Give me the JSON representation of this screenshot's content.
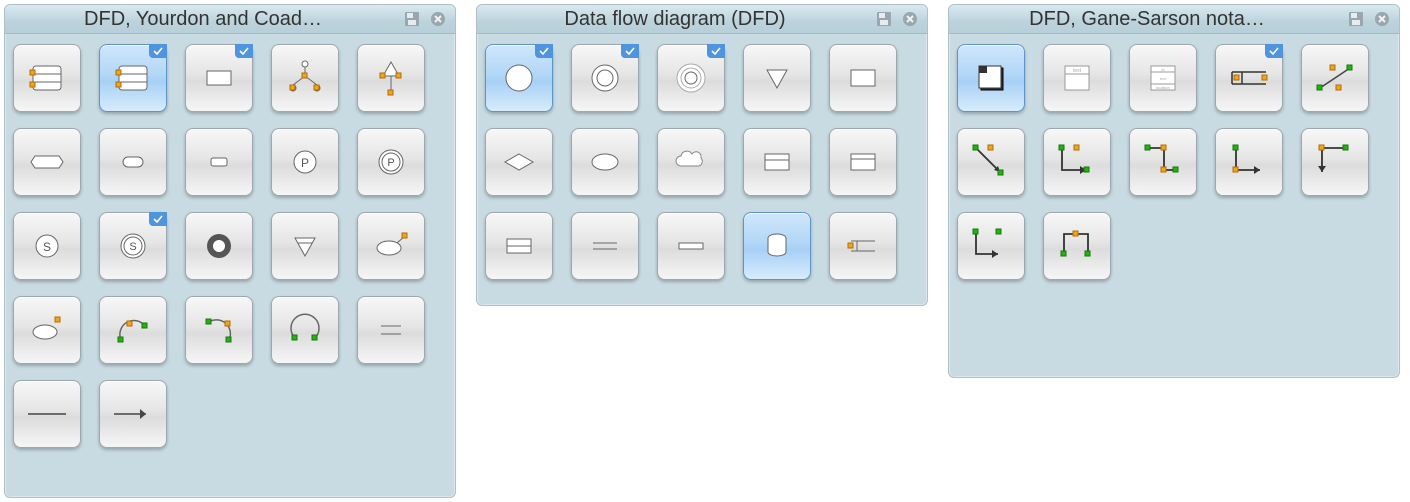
{
  "panels": [
    {
      "id": "yourdon",
      "title": "DFD, Yourdon and Coad…"
    },
    {
      "id": "dfd",
      "title": "Data flow diagram (DFD)"
    },
    {
      "id": "gane",
      "title": "DFD, Gane-Sarson nota…"
    }
  ],
  "tools": {
    "yourdon": [
      {
        "name": "data-store-stack",
        "selected": false,
        "tag": false
      },
      {
        "name": "data-store-stack-alt",
        "selected": true,
        "tag": true
      },
      {
        "name": "external-entity",
        "selected": false,
        "tag": true
      },
      {
        "name": "multi-process",
        "selected": false,
        "tag": false
      },
      {
        "name": "process-tree",
        "selected": false,
        "tag": false
      },
      {
        "name": "angled-box",
        "selected": false,
        "tag": false
      },
      {
        "name": "rounded-rect",
        "selected": false,
        "tag": false
      },
      {
        "name": "rounded-rect-small",
        "selected": false,
        "tag": false
      },
      {
        "name": "process-circle-p",
        "selected": false,
        "tag": false
      },
      {
        "name": "process-circle-p-bold",
        "selected": false,
        "tag": false
      },
      {
        "name": "state-circle-s",
        "selected": false,
        "tag": false
      },
      {
        "name": "state-circle-s-bold",
        "selected": false,
        "tag": true
      },
      {
        "name": "ring",
        "selected": false,
        "tag": false
      },
      {
        "name": "triangle-down",
        "selected": false,
        "tag": false
      },
      {
        "name": "ellipse-handle",
        "selected": false,
        "tag": false
      },
      {
        "name": "ellipse-handle-2",
        "selected": false,
        "tag": false
      },
      {
        "name": "arc-tl",
        "selected": false,
        "tag": false
      },
      {
        "name": "arc-tr",
        "selected": false,
        "tag": false
      },
      {
        "name": "arc-bl",
        "selected": false,
        "tag": false
      },
      {
        "name": "line-pair",
        "selected": false,
        "tag": false
      },
      {
        "name": "line",
        "selected": false,
        "tag": false
      },
      {
        "name": "arrow",
        "selected": false,
        "tag": false
      }
    ],
    "dfd": [
      {
        "name": "process-circle",
        "selected": true,
        "tag": true
      },
      {
        "name": "process-double",
        "selected": false,
        "tag": true
      },
      {
        "name": "process-triple",
        "selected": false,
        "tag": true
      },
      {
        "name": "triangle-down",
        "selected": false,
        "tag": false
      },
      {
        "name": "rectangle",
        "selected": false,
        "tag": false
      },
      {
        "name": "diamond",
        "selected": false,
        "tag": false
      },
      {
        "name": "ellipse",
        "selected": false,
        "tag": false
      },
      {
        "name": "cloud",
        "selected": false,
        "tag": false
      },
      {
        "name": "panel",
        "selected": false,
        "tag": false
      },
      {
        "name": "panel-2",
        "selected": false,
        "tag": false
      },
      {
        "name": "store-open",
        "selected": false,
        "tag": false
      },
      {
        "name": "store-double",
        "selected": false,
        "tag": false
      },
      {
        "name": "store-line",
        "selected": false,
        "tag": false
      },
      {
        "name": "database",
        "selected": true,
        "tag": false
      },
      {
        "name": "store-open-right",
        "selected": false,
        "tag": false
      }
    ],
    "gane": [
      {
        "name": "process-box",
        "selected": true,
        "tag": false
      },
      {
        "name": "process-box-titled",
        "selected": false,
        "tag": false
      },
      {
        "name": "process-box-sections",
        "selected": false,
        "tag": false
      },
      {
        "name": "data-store",
        "selected": false,
        "tag": true
      },
      {
        "name": "flow-diag",
        "selected": false,
        "tag": false
      },
      {
        "name": "flow-down-right",
        "selected": false,
        "tag": false
      },
      {
        "name": "flow-down-left",
        "selected": false,
        "tag": false
      },
      {
        "name": "flow-branch",
        "selected": false,
        "tag": false
      },
      {
        "name": "flow-right-down",
        "selected": false,
        "tag": false
      },
      {
        "name": "flow-left-down",
        "selected": false,
        "tag": false
      },
      {
        "name": "flow-up-right",
        "selected": false,
        "tag": false
      },
      {
        "name": "flow-split",
        "selected": false,
        "tag": false
      }
    ]
  }
}
